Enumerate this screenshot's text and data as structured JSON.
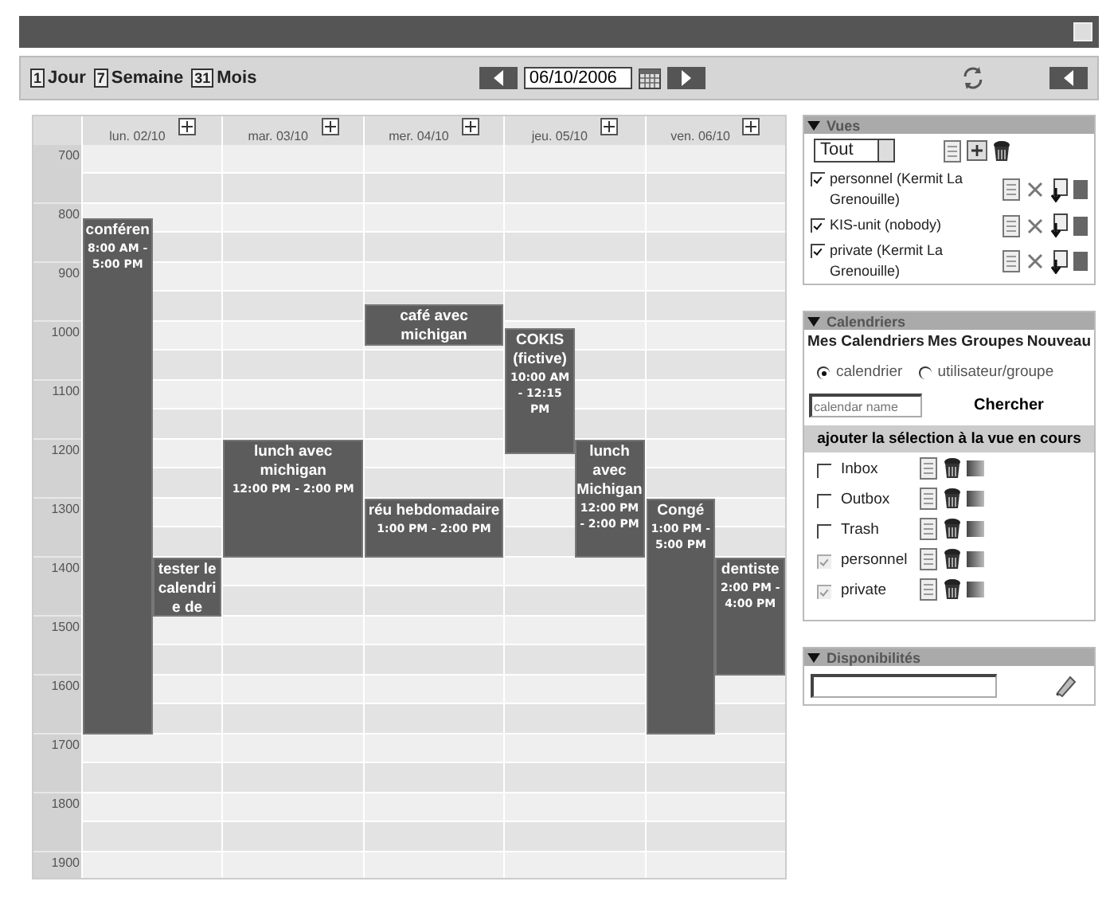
{
  "toolbar": {
    "views": [
      {
        "icon": "1",
        "label": "Jour"
      },
      {
        "icon": "7",
        "label": "Semaine"
      },
      {
        "icon": "31",
        "label": "Mois"
      }
    ],
    "date": "06/10/2006"
  },
  "hours": [
    "700",
    "800",
    "900",
    "1000",
    "1100",
    "1200",
    "1300",
    "1400",
    "1500",
    "1600",
    "1700",
    "1800",
    "1900"
  ],
  "days": [
    {
      "label": "lun. 02/10",
      "events": [
        {
          "title": "conféren",
          "time": "8:00 AM - 5:00 PM"
        },
        {
          "title": "tester le calendrie de"
        }
      ]
    },
    {
      "label": "mar. 03/10",
      "events": [
        {
          "title": "lunch avec michigan",
          "time": "12:00 PM - 2:00 PM"
        }
      ]
    },
    {
      "label": "mer. 04/10",
      "events": [
        {
          "title": "café avec michigan"
        },
        {
          "title": "réu hebdomadaire",
          "time": "1:00 PM - 2:00 PM"
        }
      ]
    },
    {
      "label": "jeu. 05/10",
      "events": [
        {
          "title": "COKIS (fictive)",
          "time": "10:00 AM - 12:15 PM"
        },
        {
          "title": "lunch avec Michigan",
          "time": "12:00 PM - 2:00 PM"
        }
      ]
    },
    {
      "label": "ven. 06/10",
      "events": [
        {
          "title": "Congé",
          "time": "1:00 PM - 5:00 PM"
        },
        {
          "title": "dentiste",
          "time": "2:00 PM - 4:00 PM"
        }
      ]
    }
  ],
  "vues": {
    "title": "Vues",
    "select": "Tout",
    "items": [
      {
        "label": "personnel (Kermit La Grenouille)",
        "checked": true
      },
      {
        "label": "KIS-unit (nobody)",
        "checked": true
      },
      {
        "label": "private (Kermit La Grenouille)",
        "checked": true
      }
    ]
  },
  "calendriers": {
    "title": "Calendriers",
    "tabs": [
      "Mes Calendriers",
      "Mes Groupes",
      "Nouveau"
    ],
    "radios": [
      {
        "label": "calendrier",
        "selected": true
      },
      {
        "label": "utilisateur/groupe",
        "selected": false
      }
    ],
    "search_placeholder": "calendar name",
    "search_button": "Chercher",
    "add_label": "ajouter la sélection à la vue en cours",
    "items": [
      {
        "label": "Inbox",
        "checked": false,
        "disabled": false
      },
      {
        "label": "Outbox",
        "checked": false,
        "disabled": false
      },
      {
        "label": "Trash",
        "checked": false,
        "disabled": false
      },
      {
        "label": "personnel",
        "checked": true,
        "disabled": true
      },
      {
        "label": "private",
        "checked": true,
        "disabled": true
      }
    ]
  },
  "disponibilites": {
    "title": "Disponibilités"
  }
}
